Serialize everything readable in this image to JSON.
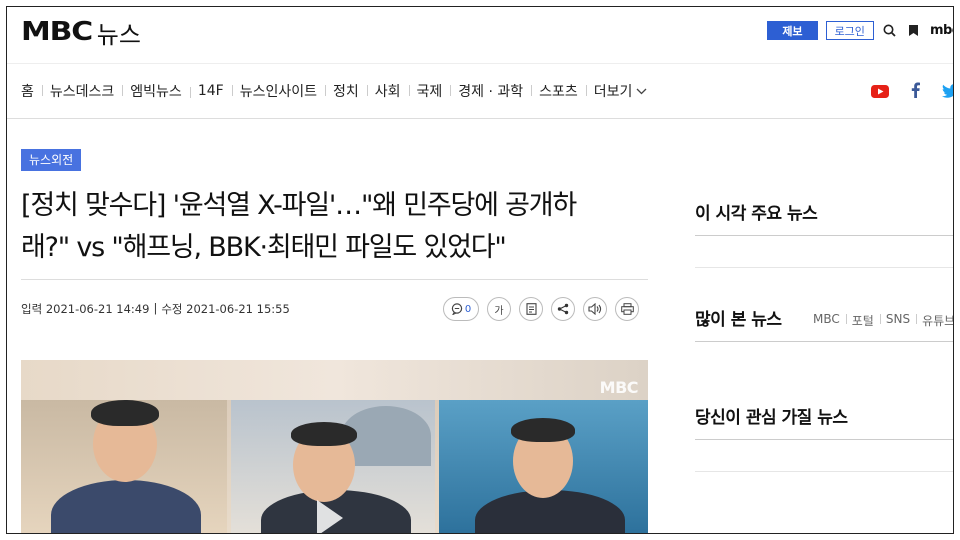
{
  "header": {
    "logo_mbc": "MBC",
    "logo_news": "뉴스",
    "report_label": "제보",
    "login_label": "로그인",
    "util_mbc_label": "mbc"
  },
  "nav": {
    "items": [
      "홈",
      "뉴스데스크",
      "엠빅뉴스",
      "14F",
      "뉴스인사이트",
      "정치",
      "사회",
      "국제",
      "경제 · 과학",
      "스포츠"
    ],
    "more_label": "더보기"
  },
  "social": {
    "icons": [
      "youtube-icon",
      "facebook-icon",
      "twitter-icon"
    ],
    "colors": {
      "youtube": "#e62117",
      "facebook": "#3b5998",
      "twitter": "#1da1f2"
    }
  },
  "article": {
    "tag": "뉴스외전",
    "title_line1": "[정치 맞수다] '윤석열 X-파일'…\"왜 민주당에 공개하",
    "title_line2": "래?\" vs \"해프닝, BBK·최태민 파일도 있었다\"",
    "input_date": "입력 2021-06-21 14:49",
    "separator": "|",
    "edit_date": "수정 2021-06-21 15:55",
    "tools": {
      "comment_count": "0",
      "font_label": "가"
    },
    "photo_watermark": "MBC",
    "accent_color": "#2d5fd3"
  },
  "sidebar": {
    "now_news_title": "이 시각 주요 뉴스",
    "most_viewed_title": "많이 본 뉴스",
    "most_viewed_tabs": [
      "MBC",
      "포털",
      "SNS",
      "유튜브"
    ],
    "interest_title": "당신이 관심 가질 뉴스"
  }
}
